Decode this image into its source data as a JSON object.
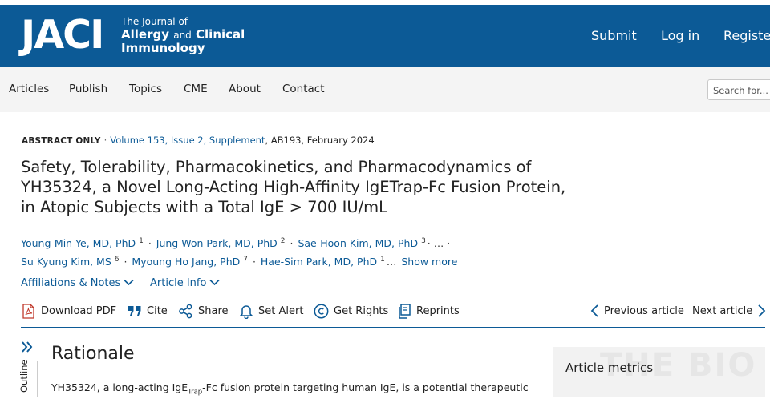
{
  "header": {
    "logo": "JACI",
    "journal_line1": "The Journal of",
    "journal_line2a": "Allergy",
    "journal_line2b": "and",
    "journal_line2c": "Clinical",
    "journal_line3": "Immunology",
    "links": [
      "Submit",
      "Log in",
      "Registe"
    ]
  },
  "nav": {
    "items": [
      "Articles",
      "Publish",
      "Topics",
      "CME",
      "About",
      "Contact"
    ],
    "search_placeholder": "Search for..."
  },
  "article": {
    "type": "ABSTRACT ONLY",
    "separator": "·",
    "issue": "Volume 153, Issue 2, Supplement",
    "pages_date": ", AB193, February 2024",
    "title": "Safety, Tolerability, Pharmacokinetics, and Pharmacodynamics of YH35324, a Novel Long-Acting High-Affinity IgETrap-Fc Fusion Protein, in Atopic Subjects with a Total IgE > 700 IU/mL",
    "authors_row1": [
      {
        "name": "Young-Min Ye, MD, PhD",
        "sup": "1"
      },
      {
        "name": "Jung-Won Park, MD, PhD",
        "sup": "2"
      },
      {
        "name": "Sae-Hoon Kim, MD, PhD",
        "sup": "3"
      }
    ],
    "authors_row1_tail": "· … ·",
    "authors_row2": [
      {
        "name": "Su Kyung Kim, MS",
        "sup": "6"
      },
      {
        "name": "Myoung Ho Jang, PhD",
        "sup": "7"
      },
      {
        "name": "Hae-Sim Park, MD, PhD",
        "sup": "1"
      }
    ],
    "ellipsis": "…",
    "show_more": "Show more",
    "affiliations": "Affiliations & Notes",
    "article_info": "Article Info"
  },
  "toolbar": {
    "download_pdf": "Download PDF",
    "cite": "Cite",
    "share": "Share",
    "set_alert": "Set Alert",
    "get_rights": "Get Rights",
    "reprints": "Reprints",
    "previous": "Previous article",
    "next": "Next article"
  },
  "body": {
    "outline_label": "Outline",
    "section_title": "Rationale",
    "text_before": "YH35324, a long-acting IgE",
    "text_sub": "Trap",
    "text_after": "-Fc fusion protein targeting human IgE, is a potential therapeutic"
  },
  "sidebar": {
    "metrics_title": "Article metrics",
    "watermark": "THE BIO"
  },
  "colors": {
    "brand": "#0c5a96",
    "nav_bg": "#f4f4f4",
    "panel_bg": "#f2f2f2",
    "pdf_icon": "#c0392b"
  }
}
